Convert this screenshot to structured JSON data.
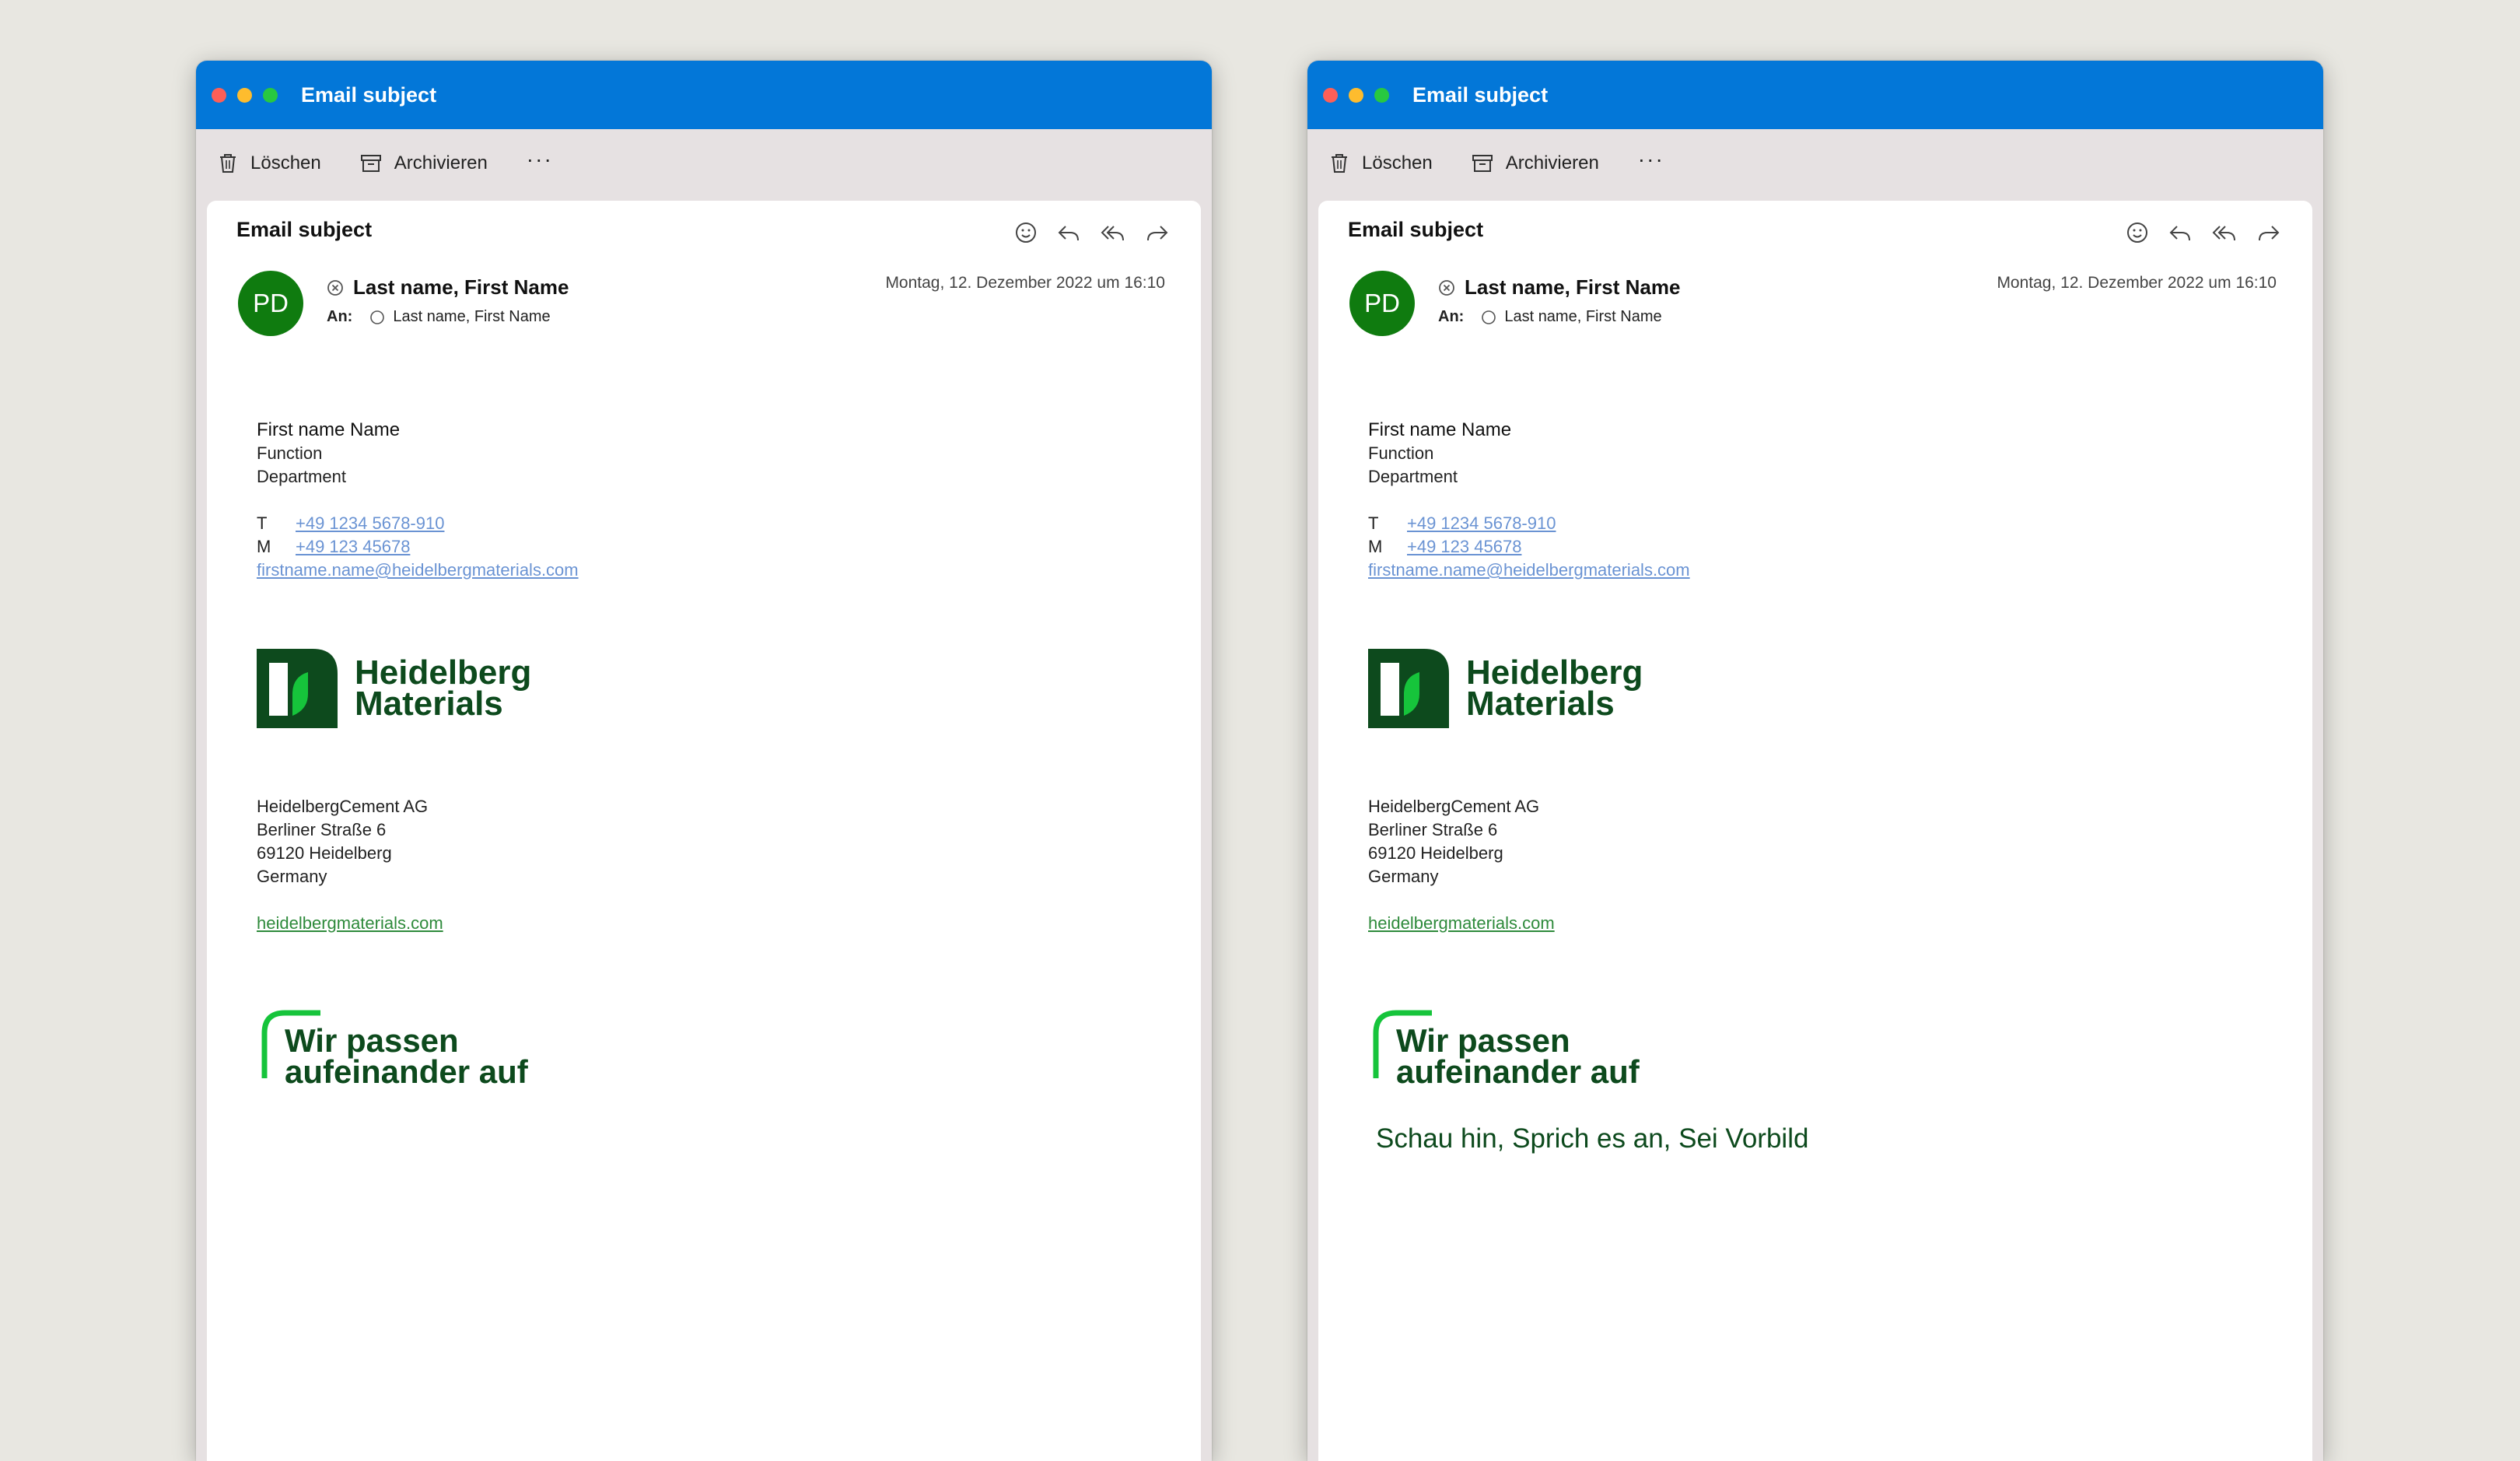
{
  "windows": [
    {
      "title": "Email subject",
      "toolbar": {
        "delete_label": "Löschen",
        "archive_label": "Archivieren",
        "more_label": "···"
      },
      "message": {
        "subject": "Email subject",
        "avatar_initials": "PD",
        "from_name": "Last name, First Name",
        "to_label": "An:",
        "to_name": "Last name, First Name",
        "date": "Montag, 12. Dezember 2022 um 16:10"
      },
      "signature": {
        "name": "First name Name",
        "function": "Function",
        "department": "Department",
        "phone_label": "T",
        "phone": "+49 1234 5678-910",
        "mobile_label": "M",
        "mobile": "+49 123 45678",
        "email": "firstname.name@heidelbergmaterials.com",
        "logo_line1": "Heidelberg",
        "logo_line2": "Materials",
        "company": "HeidelbergCement AG",
        "street": "Berliner Straße 6",
        "city": "69120 Heidelberg",
        "country": "Germany",
        "website": "heidelbergmaterials.com",
        "slogan_line1": "Wir passen",
        "slogan_line2": "aufeinander auf",
        "claim": ""
      }
    },
    {
      "title": "Email subject",
      "toolbar": {
        "delete_label": "Löschen",
        "archive_label": "Archivieren",
        "more_label": "···"
      },
      "message": {
        "subject": "Email subject",
        "avatar_initials": "PD",
        "from_name": "Last name, First Name",
        "to_label": "An:",
        "to_name": "Last name, First Name",
        "date": "Montag, 12. Dezember 2022 um 16:10"
      },
      "signature": {
        "name": "First name Name",
        "function": "Function",
        "department": "Department",
        "phone_label": "T",
        "phone": "+49 1234 5678-910",
        "mobile_label": "M",
        "mobile": "+49 123 45678",
        "email": "firstname.name@heidelbergmaterials.com",
        "logo_line1": "Heidelberg",
        "logo_line2": "Materials",
        "company": "HeidelbergCement AG",
        "street": "Berliner Straße 6",
        "city": "69120 Heidelberg",
        "country": "Germany",
        "website": "heidelbergmaterials.com",
        "slogan_line1": "Wir passen",
        "slogan_line2": "aufeinander auf",
        "claim": "Schau hin, Sprich es an, Sei Vorbild"
      }
    }
  ],
  "colors": {
    "titlebar": "#0377d8",
    "avatar": "#0f7b0f",
    "brand_dark_green": "#0d4a1d",
    "brand_light_green": "#16c43b",
    "link_blue": "#6a93d3",
    "link_green": "#2e8a3b"
  },
  "icons": [
    "trash-icon",
    "archive-icon",
    "emoji-icon",
    "reply-icon",
    "reply-all-icon",
    "forward-icon",
    "remove-circle-icon",
    "recipient-circle-icon"
  ]
}
